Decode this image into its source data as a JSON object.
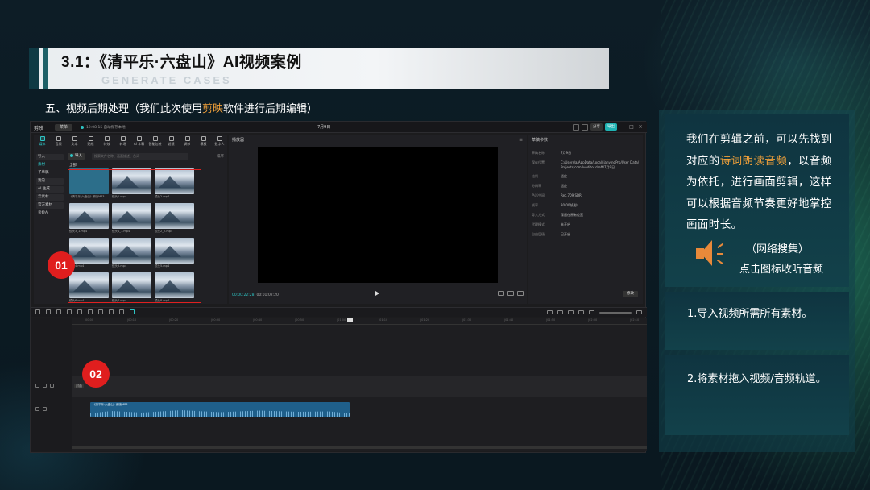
{
  "slide": {
    "title": "3.1：《清平乐·六盘山》AI视频案例",
    "title_sub": "GENERATE CASES",
    "subtitle_pre": "五、视频后期处理（我们此次使用",
    "subtitle_hl": "剪映",
    "subtitle_post": "软件进行后期编辑）",
    "accent_color": "#f0a03a"
  },
  "editor": {
    "logo": "剪映",
    "menu": "菜单",
    "autosave": "12:08:15 自动保存本地",
    "project_name": "7月9日",
    "top_buttons": [
      "分享",
      "导出"
    ],
    "media_tabs": [
      "媒体",
      "音频",
      "文本",
      "贴纸",
      "特效",
      "转场",
      "AI 字幕",
      "智能包装",
      "滤镜",
      "调节",
      "模板",
      "数字人"
    ],
    "media_side": [
      "导入",
      "素材",
      "子草稿",
      "我的",
      "AI 生成",
      "云素材",
      "官方素材",
      "亲妙AI"
    ],
    "import_label": "导入",
    "search_placeholder": "搜索文件名称、画面描述、台词",
    "sort_label": "排序",
    "all_label": "全部",
    "thumbs": [
      {
        "label": "《清平乐·六盘山》朗读MP3",
        "type": "audio"
      },
      {
        "label": "镜头1.mp4",
        "type": "video"
      },
      {
        "label": "镜头2.mp4",
        "type": "video"
      },
      {
        "label": "镜头3_1.mp4",
        "type": "video"
      },
      {
        "label": "镜头1_1.mp4",
        "type": "video"
      },
      {
        "label": "镜头2_2.mp4",
        "type": "video"
      },
      {
        "label": "镜头4.mp4",
        "type": "video"
      },
      {
        "label": "镜头3.mp4",
        "type": "video"
      },
      {
        "label": "镜头5.mp4",
        "type": "video"
      },
      {
        "label": "镜头6.mp4",
        "type": "video"
      },
      {
        "label": "镜头7.mp4",
        "type": "video"
      },
      {
        "label": "镜头8.mp4",
        "type": "video"
      }
    ],
    "player_title": "播放器",
    "player_time": "00:00:22:28",
    "player_total": "00:01:02:20",
    "props_title": "草稿参数",
    "props": [
      {
        "k": "草稿名称",
        "v": "7月9日"
      },
      {
        "k": "保存位置",
        "v": "C:/Users/a/AppData/Local/JianyingPro/User Data/Projects/com.lveditor.draft/7月9日"
      },
      {
        "k": "比例",
        "v": "适应"
      },
      {
        "k": "分辨率",
        "v": "适应"
      },
      {
        "k": "色彩空间",
        "v": "Rec.709 SDR"
      },
      {
        "k": "帧率",
        "v": "30.00帧/秒"
      },
      {
        "k": "导入方式",
        "v": "保留在原有位置"
      },
      {
        "k": "代理模式",
        "v": "未开启"
      },
      {
        "k": "自由层级",
        "v": "已开启"
      }
    ],
    "props_button": "修改",
    "ruler_ticks": [
      "00:00",
      "|00:10",
      "|00:20",
      "|00:30",
      "|00:40",
      "|00:50",
      "|01:00",
      "|01:10",
      "|01:20",
      "|01:30",
      "|01:40",
      "|01:50",
      "|02:00",
      "|02:10",
      "|02:20",
      "|02:30"
    ],
    "cover_label": "封面",
    "audio_clip_name": "《清平乐·六盘山》朗读MP3"
  },
  "badges": [
    "01",
    "02"
  ],
  "panel": {
    "intro_1": "我们在剪辑之前，可以先找到对应的",
    "intro_hl": "诗词朗读音频",
    "intro_2": "，以音频为依托，进行画面剪辑，这样可以根据音频节奏更好地掌控画面时长。",
    "net_search": "（网络搜集）",
    "click_listen": "点击图标收听音频",
    "speaker_icon": "speaker-icon",
    "step1": "1.导入视频所需所有素材。",
    "step2": "2.将素材拖入视频/音频轨道。"
  }
}
